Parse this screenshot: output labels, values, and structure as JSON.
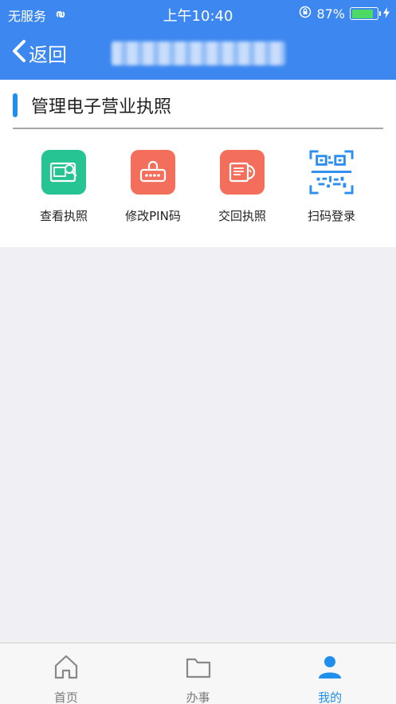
{
  "status_bar": {
    "carrier": "无服务",
    "time": "上午10:40",
    "battery_percent": "87%",
    "battery_level": 0.87
  },
  "nav": {
    "back_label": "返回"
  },
  "section": {
    "title": "管理电子营业执照"
  },
  "actions": [
    {
      "label": "查看执照",
      "icon": "view-license-icon",
      "color": "#27c493"
    },
    {
      "label": "修改PIN码",
      "icon": "pin-code-icon",
      "color": "#f36f5b"
    },
    {
      "label": "交回执照",
      "icon": "return-license-icon",
      "color": "#f36f5b"
    },
    {
      "label": "扫码登录",
      "icon": "qr-code-icon",
      "color": "#2c8ff0"
    }
  ],
  "tabbar": {
    "tabs": [
      {
        "label": "首页",
        "icon": "home-icon",
        "active": false
      },
      {
        "label": "办事",
        "icon": "folder-icon",
        "active": false
      },
      {
        "label": "我的",
        "icon": "user-icon",
        "active": true
      }
    ]
  },
  "colors": {
    "brand_blue": "#3c87f0",
    "accent_blue": "#1f8fef",
    "page_bg": "#efeff4"
  }
}
